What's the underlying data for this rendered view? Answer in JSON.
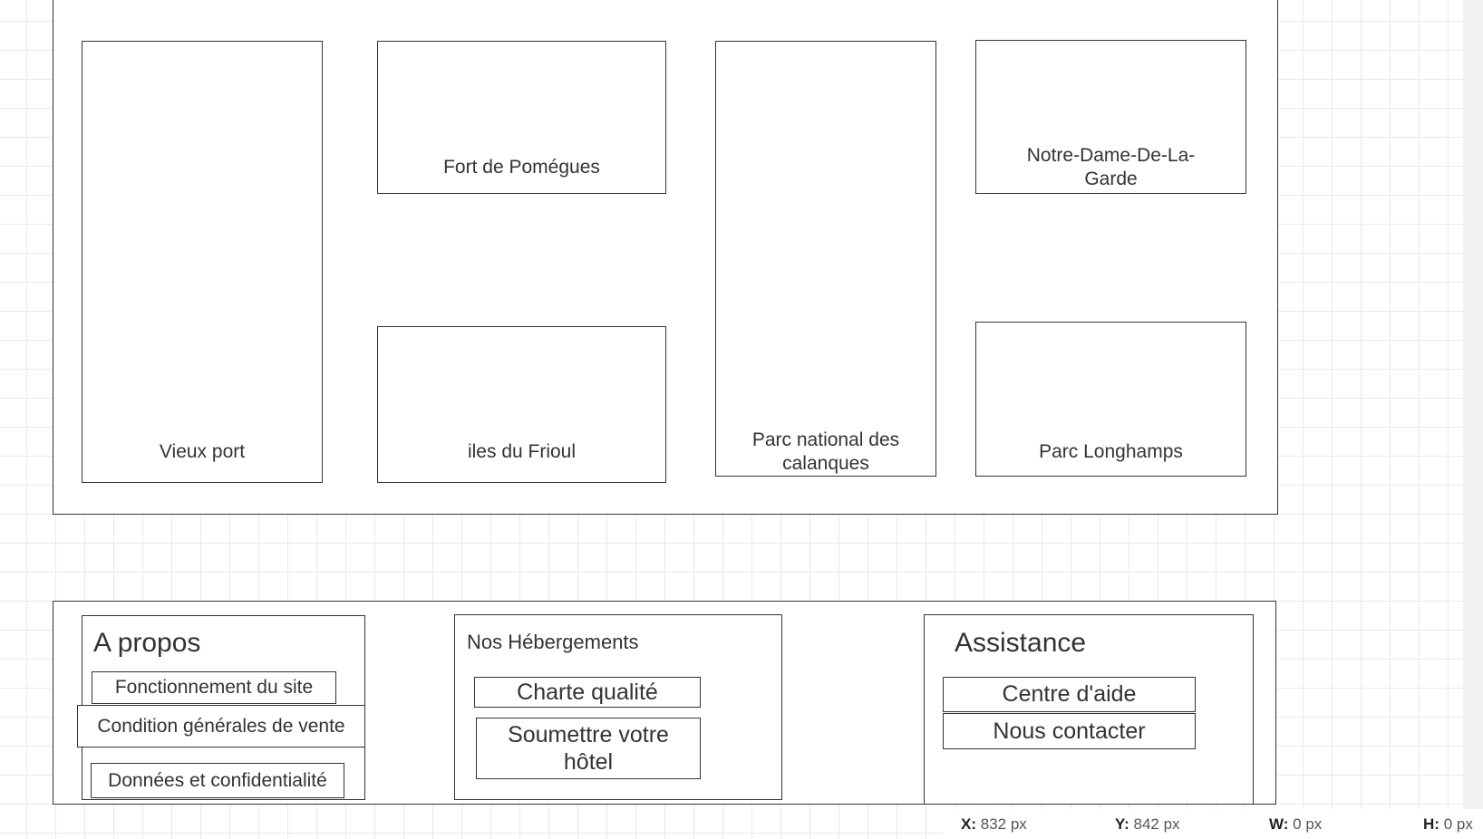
{
  "gallery": {
    "cards": [
      {
        "id": "vieux-port",
        "label": "Vieux port"
      },
      {
        "id": "fort-pomegues",
        "label": "Fort de Pomégues"
      },
      {
        "id": "iles-frioul",
        "label": "iles du Frioul"
      },
      {
        "id": "calanques",
        "label_line1": "Parc national des",
        "label_line2": "calanques"
      },
      {
        "id": "notre-dame",
        "label_line1": "Notre-Dame-De-La-",
        "label_line2": "Garde"
      },
      {
        "id": "longhamps",
        "label": "Parc Longhamps"
      }
    ]
  },
  "footer": {
    "about": {
      "title": "A propos",
      "links": [
        "Fonctionnement du site",
        "Condition générales de vente",
        "Données et confidentialité"
      ]
    },
    "accommodations": {
      "title": "Nos Hébergements",
      "links": [
        "Charte qualité",
        "Soumettre votre hôtel"
      ]
    },
    "assistance": {
      "title": "Assistance",
      "links": [
        "Centre d'aide",
        "Nous contacter"
      ]
    }
  },
  "status": {
    "x_label": "X:",
    "x_value": "832 px",
    "y_label": "Y:",
    "y_value": "842 px",
    "w_label": "W:",
    "w_value": "0 px",
    "h_label": "H:",
    "h_value": "0 px"
  }
}
